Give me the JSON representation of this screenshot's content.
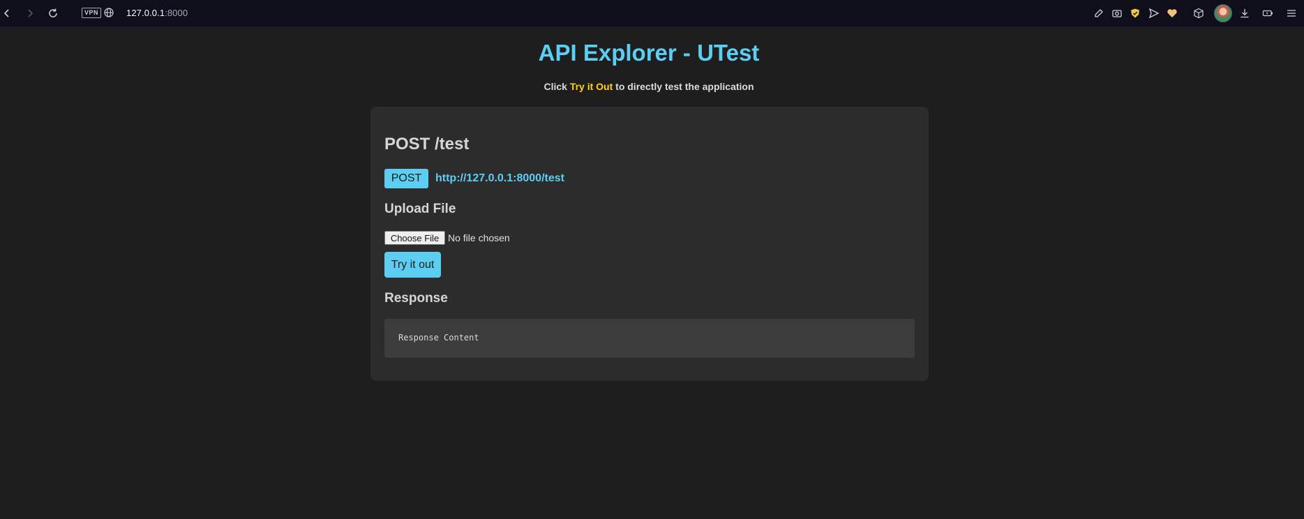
{
  "browser": {
    "url_host": "127.0.0.1",
    "url_port": ":8000",
    "vpn_label": "VPN",
    "icons": [
      "back-icon",
      "forward-icon",
      "reload-icon",
      "globe-icon",
      "edit-icon",
      "camera-icon",
      "shield-icon",
      "send-icon",
      "heart-icon",
      "cube-icon",
      "download-icon",
      "battery-icon",
      "menu-icon"
    ]
  },
  "page": {
    "title": "API Explorer - UTest",
    "subtitle_prefix": "Click ",
    "subtitle_highlight": "Try it Out",
    "subtitle_suffix": " to directly test the application"
  },
  "endpoint": {
    "heading": "POST /test",
    "method": "POST",
    "url": "http://127.0.0.1:8000/test"
  },
  "upload": {
    "heading": "Upload File",
    "choose_label": "Choose File",
    "status": "No file chosen"
  },
  "actions": {
    "try_label": "Try it out"
  },
  "response": {
    "heading": "Response",
    "content": "Response Content"
  },
  "colors": {
    "accent": "#5ccef2",
    "highlight": "#ffd21f",
    "background": "#1e1e1e",
    "card": "#2c2c2c"
  }
}
